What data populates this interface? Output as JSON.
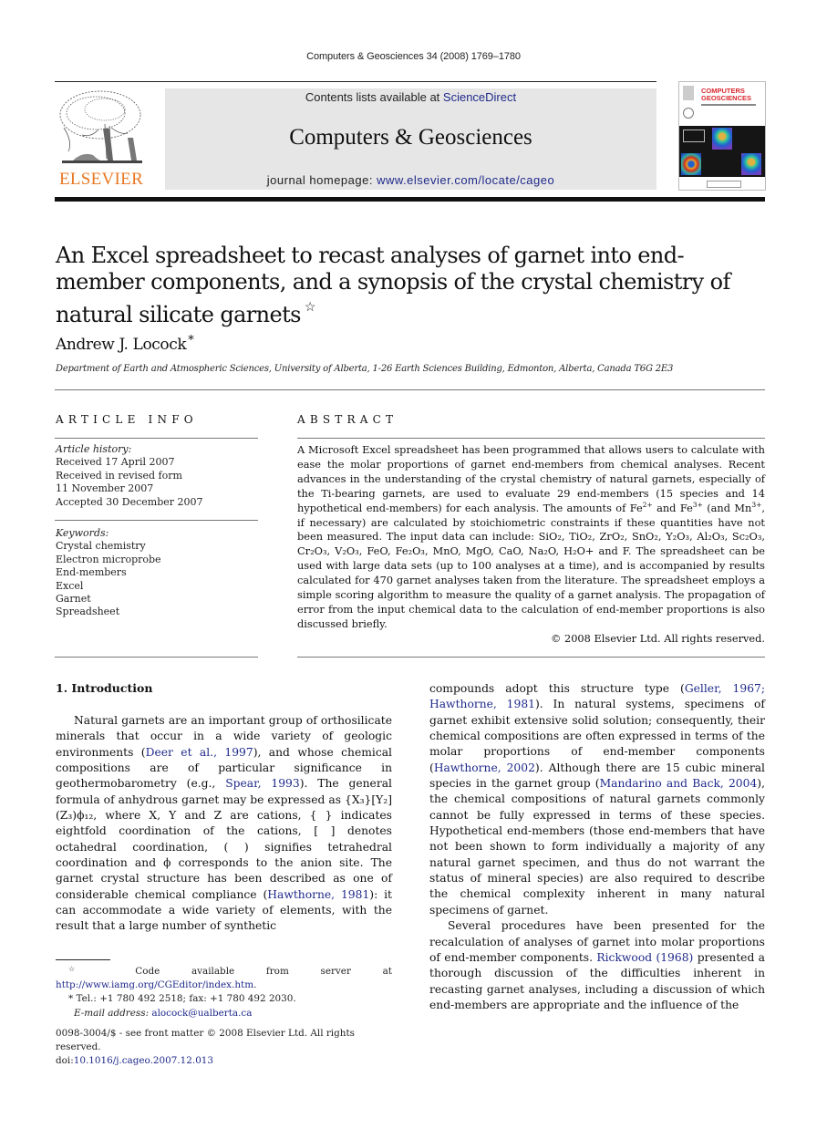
{
  "running_head": "Computers & Geosciences 34 (2008) 1769–1780",
  "masthead": {
    "publisher_logo": "ELSEVIER",
    "contents_prefix": "Contents lists available at ",
    "contents_link": "ScienceDirect",
    "journal_title": "Computers & Geosciences",
    "homepage_prefix": "journal homepage: ",
    "homepage_link": "www.elsevier.com/locate/cageo",
    "cover_title_line1": "COMPUTERS",
    "cover_title_line2": "GEOSCIENCES",
    "brand_color": "#e87722",
    "link_color": "#1f2a8a"
  },
  "article": {
    "title": "An Excel spreadsheet to recast analyses of garnet into end-member components, and a synopsis of the crystal chemistry of natural silicate garnets",
    "title_note_mark": "☆",
    "author": "Andrew J. Locock",
    "author_mark": "*",
    "affiliation": "Department of Earth and Atmospheric Sciences, University of Alberta, 1-26 Earth Sciences Building, Edmonton, Alberta, Canada T6G 2E3"
  },
  "article_info": {
    "heading": "ARTICLE INFO",
    "history_label": "Article history:",
    "history": [
      "Received 17 April 2007",
      "Received in revised form",
      "11 November 2007",
      "Accepted 30 December 2007"
    ],
    "keywords_label": "Keywords:",
    "keywords": [
      "Crystal chemistry",
      "Electron microprobe",
      "End-members",
      "Excel",
      "Garnet",
      "Spreadsheet"
    ]
  },
  "abstract": {
    "heading": "ABSTRACT",
    "p1": "A Microsoft Excel spreadsheet has been programmed that allows users to calculate with ease the molar proportions of garnet end-members from chemical analyses. Recent advances in the understanding of the crystal chemistry of natural garnets, especially of the Ti-bearing garnets, are used to evaluate 29 end-members (15 species and 14 hypothetical end-members) for each analysis. The amounts of Fe",
    "fe2": "2+",
    "p2": " and Fe",
    "fe3": "3+",
    "p3": " (and Mn",
    "mn3": "3+",
    "p4": ", if necessary) are calculated by stoichiometric constraints if these quantities have not been measured. The input data can include: ",
    "oxides": "SiO₂, TiO₂, ZrO₂, SnO₂, Y₂O₃, Al₂O₃, Sc₂O₃, Cr₂O₃, V₂O₃, FeO, Fe₂O₃, MnO, MgO, CaO, Na₂O, H₂O+ and F.",
    "p5": " The spreadsheet can be used with large data sets (up to 100 analyses at a time), and is accompanied by results calculated for 470 garnet analyses taken from the literature. The spreadsheet employs a simple scoring algorithm to measure the quality of a garnet analysis. The propagation of error from the input chemical data to the calculation of end-member proportions is also discussed briefly.",
    "copyright": "© 2008 Elsevier Ltd. All rights reserved."
  },
  "body": {
    "section_heading": "1.  Introduction",
    "left": {
      "t1": "Natural garnets are an important group of orthosilicate minerals that occur in a wide variety of geologic environments (",
      "c1": "Deer et al., 1997",
      "t2": "), and whose chemical compositions are of particular significance in geothermobarometry (e.g., ",
      "c2": "Spear, 1993",
      "t3": "). The general formula of anhydrous garnet may be expressed as {X₃}[Y₂](Z₃)ϕ₁₂, where X, Y and Z are cations, { } indicates eightfold coordination of the cations, [ ] denotes octahedral coordination, ( ) signifies tetrahedral coordination and ϕ corresponds to the anion site. The garnet crystal structure has been described as one of considerable chemical compliance (",
      "c3": "Hawthorne, 1981",
      "t4": "): it can accommodate a wide variety of elements, with the result that a large number of synthetic"
    },
    "right": {
      "t1": "compounds adopt this structure type (",
      "c1": "Geller, 1967; Hawthorne, 1981",
      "t2": "). In natural systems, specimens of garnet exhibit extensive solid solution; consequently, their chemical compositions are often expressed in terms of the molar proportions of end-member components (",
      "c2": "Hawthorne, 2002",
      "t3": "). Although there are 15 cubic mineral species in the garnet group (",
      "c3": "Mandarino and Back, 2004",
      "t4": "), the chemical compositions of natural garnets commonly cannot be fully expressed in terms of these species. Hypothetical end-members (those end-members that have not been shown to form individually a majority of any natural garnet specimen, and thus do not warrant the status of mineral species) are also required to describe the chemical complexity inherent in many natural specimens of garnet.",
      "p2_t1": "Several procedures have been presented for the recalculation of analyses of garnet into molar proportions of end-member components. ",
      "p2_c1": "Rickwood (1968)",
      "p2_t2": " presented a thorough discussion of the difficulties inherent in recasting garnet analyses, including a discussion of which end-members are appropriate and the influence of the"
    }
  },
  "footnotes": {
    "code_mark": "☆",
    "code_text": " Code available from server at ",
    "code_link": "http://www.iamg.org/CGEditor/index.htm",
    "code_end": ".",
    "tel_mark": "*",
    "tel_text": " Tel.: +1 780 492 2518; fax: +1 780 492 2030.",
    "email_label": "E-mail address: ",
    "email": "alocock@ualberta.ca",
    "front_matter": "0098-3004/$ - see front matter © 2008 Elsevier Ltd. All rights reserved.",
    "doi_label": "doi:",
    "doi": "10.1016/j.cageo.2007.12.013"
  }
}
